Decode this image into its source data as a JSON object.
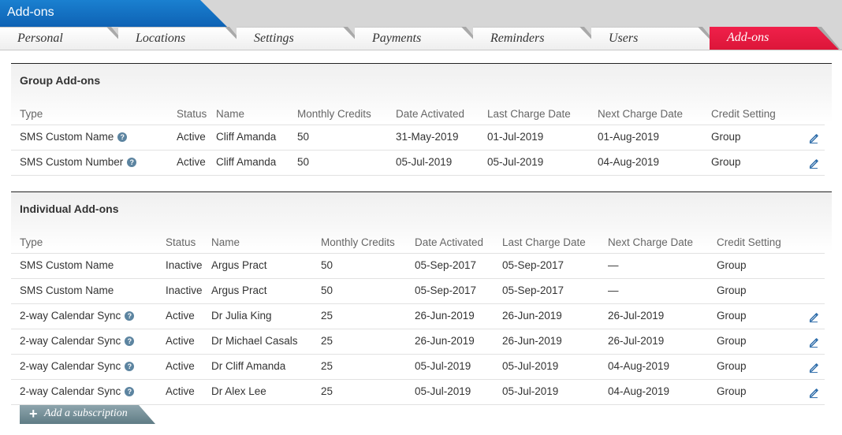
{
  "app_title": "Add-ons",
  "tabs": [
    "Personal",
    "Locations",
    "Settings",
    "Payments",
    "Reminders",
    "Users",
    "Add-ons"
  ],
  "active_tab": "Add-ons",
  "group": {
    "title": "Group Add-ons",
    "columns": [
      "Type",
      "Status",
      "Name",
      "Monthly Credits",
      "Date Activated",
      "Last Charge Date",
      "Next Charge Date",
      "Credit Setting"
    ],
    "rows": [
      {
        "type": "SMS Custom Name",
        "help": true,
        "status": "Active",
        "name": "Cliff Amanda",
        "credits": "50",
        "activated": "31-May-2019",
        "last": "01-Jul-2019",
        "next": "01-Aug-2019",
        "setting": "Group",
        "editable": true
      },
      {
        "type": "SMS Custom Number",
        "help": true,
        "status": "Active",
        "name": "Cliff Amanda",
        "credits": "50",
        "activated": "05-Jul-2019",
        "last": "05-Jul-2019",
        "next": "04-Aug-2019",
        "setting": "Group",
        "editable": true
      }
    ]
  },
  "individual": {
    "title": "Individual Add-ons",
    "columns": [
      "Type",
      "Status",
      "Name",
      "Monthly Credits",
      "Date Activated",
      "Last Charge Date",
      "Next Charge Date",
      "Credit Setting"
    ],
    "rows": [
      {
        "type": "SMS Custom Name",
        "help": false,
        "status": "Inactive",
        "name": "Argus Pract",
        "credits": "50",
        "activated": "05-Sep-2017",
        "last": "05-Sep-2017",
        "next": "—",
        "setting": "Group",
        "editable": false
      },
      {
        "type": "SMS Custom Name",
        "help": false,
        "status": "Inactive",
        "name": "Argus Pract",
        "credits": "50",
        "activated": "05-Sep-2017",
        "last": "05-Sep-2017",
        "next": "—",
        "setting": "Group",
        "editable": false
      },
      {
        "type": "2-way Calendar Sync",
        "help": true,
        "status": "Active",
        "name": "Dr Julia King",
        "credits": "25",
        "activated": "26-Jun-2019",
        "last": "26-Jun-2019",
        "next": "26-Jul-2019",
        "setting": "Group",
        "editable": true
      },
      {
        "type": "2-way Calendar Sync",
        "help": true,
        "status": "Active",
        "name": "Dr Michael Casals",
        "credits": "25",
        "activated": "26-Jun-2019",
        "last": "26-Jun-2019",
        "next": "26-Jul-2019",
        "setting": "Group",
        "editable": true
      },
      {
        "type": "2-way Calendar Sync",
        "help": true,
        "status": "Active",
        "name": "Dr Cliff Amanda",
        "credits": "25",
        "activated": "05-Jul-2019",
        "last": "05-Jul-2019",
        "next": "04-Aug-2019",
        "setting": "Group",
        "editable": true
      },
      {
        "type": "2-way Calendar Sync",
        "help": true,
        "status": "Active",
        "name": "Dr Alex Lee",
        "credits": "25",
        "activated": "05-Jul-2019",
        "last": "05-Jul-2019",
        "next": "04-Aug-2019",
        "setting": "Group",
        "editable": true
      }
    ]
  },
  "add_subscription": {
    "label": "Add a subscription",
    "icon": "plus-icon"
  },
  "help_glyph": "?",
  "icons": {
    "help": "question-circle-icon",
    "edit": "pencil-edit-icon"
  },
  "colors": {
    "title_tab": "#0e62b4",
    "active_tab": "#e81a41",
    "add_button": "#6f8990",
    "help_icon": "#5c84a0",
    "edit_icon": "#2a6aa8"
  }
}
